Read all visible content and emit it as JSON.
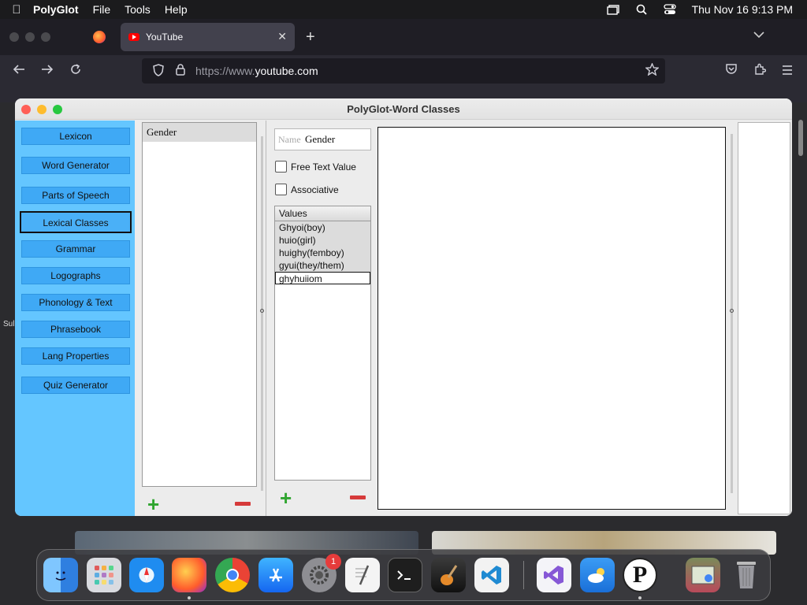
{
  "menubar": {
    "app_name": "PolyGlot",
    "menus": [
      "File",
      "Tools",
      "Help"
    ],
    "clock": "Thu Nov 16  9:13 PM",
    "icons": [
      "apple-icon",
      "window-icon",
      "search-icon",
      "control-center-icon"
    ]
  },
  "browser": {
    "tab_title": "YouTube",
    "tab_close": "✕",
    "new_tab": "+",
    "url_prefix": "https://www.",
    "url_domain": "youtube.com"
  },
  "desktop": {
    "left_label": "Sul"
  },
  "window": {
    "title": "PolyGlot-Word Classes",
    "colors": {
      "close": "#ff5f57",
      "minimize": "#febc2e",
      "zoom": "#28c840",
      "sidebar": "#64c6ff",
      "sidebar_button": "#3fa9f5"
    }
  },
  "sidebar": {
    "items": [
      {
        "label": "Lexicon"
      },
      {
        "label": "Word Generator"
      },
      {
        "label": "Parts of Speech"
      },
      {
        "label": "Lexical Classes"
      },
      {
        "label": "Grammar"
      },
      {
        "label": "Logographs"
      },
      {
        "label": "Phonology & Text"
      },
      {
        "label": "Phrasebook"
      },
      {
        "label": "Lang Properties"
      },
      {
        "label": "Quiz Generator"
      }
    ],
    "selected": "Lexical Classes"
  },
  "classes": {
    "items": [
      "Gender"
    ],
    "add_label": "+"
  },
  "detail": {
    "name_label": "Name",
    "name_value": "Gender",
    "free_text_label": "Free Text Value",
    "associative_label": "Associative",
    "values_header": "Values",
    "values": [
      "Ghyoi(boy)",
      "huio(girl)",
      "huighy(femboy)",
      "gyui(they/them)"
    ],
    "editing_value": "ghyhuiiom",
    "add_label": "+"
  },
  "dock": {
    "settings_badge": "1",
    "apps": [
      "finder-icon",
      "launchpad-icon",
      "safari-icon",
      "firefox-icon",
      "chrome-icon",
      "app-store-icon",
      "system-settings-icon",
      "textedit-icon",
      "terminal-icon",
      "garageband-icon",
      "vscode-icon",
      "visual-studio-icon",
      "weather-icon",
      "polyglot-icon",
      "preview-icon",
      "trash-icon"
    ]
  }
}
